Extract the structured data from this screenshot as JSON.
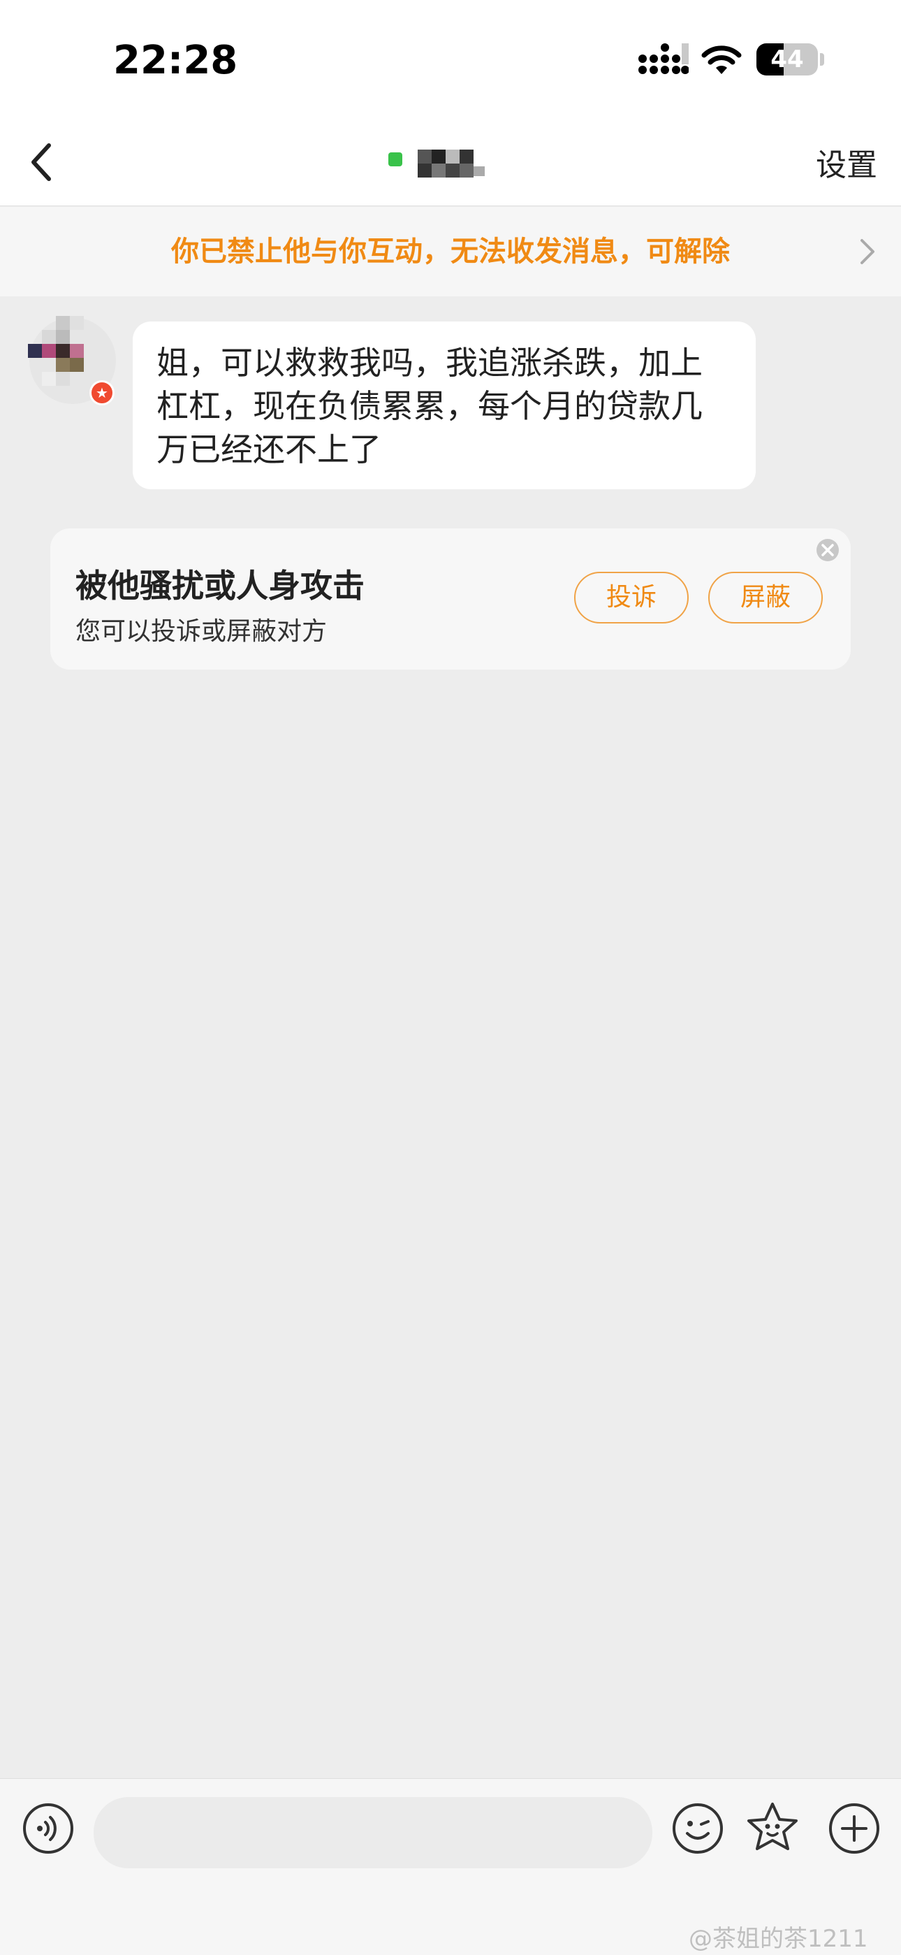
{
  "status_bar": {
    "time": "22:28",
    "battery": "44",
    "battery_level": 0.44
  },
  "navbar": {
    "settings_label": "设置"
  },
  "banner": {
    "text": "你已禁止他与你互动，无法收发消息，可解除"
  },
  "messages": [
    {
      "sender": "other",
      "text": "姐，可以救救我吗，我追涨杀跌，加上杠杠，现在负债累累，每个月的贷款几万已经还不上了"
    }
  ],
  "harassment_card": {
    "title": "被他骚扰或人身攻击",
    "subtitle": "您可以投诉或屏蔽对方",
    "complain_label": "投诉",
    "block_label": "屏蔽"
  },
  "input": {
    "placeholder": ""
  },
  "watermark": "@茶姐的茶1211",
  "colors": {
    "accent": "#f08a14",
    "online": "#39c24a",
    "badge": "#f04a30",
    "background": "#ededed"
  },
  "icons": [
    "back-icon",
    "chevron-right-icon",
    "close-icon",
    "voice-icon",
    "emoji-icon",
    "sticker-icon",
    "plus-icon",
    "signal-icon",
    "wifi-icon",
    "battery-icon"
  ]
}
